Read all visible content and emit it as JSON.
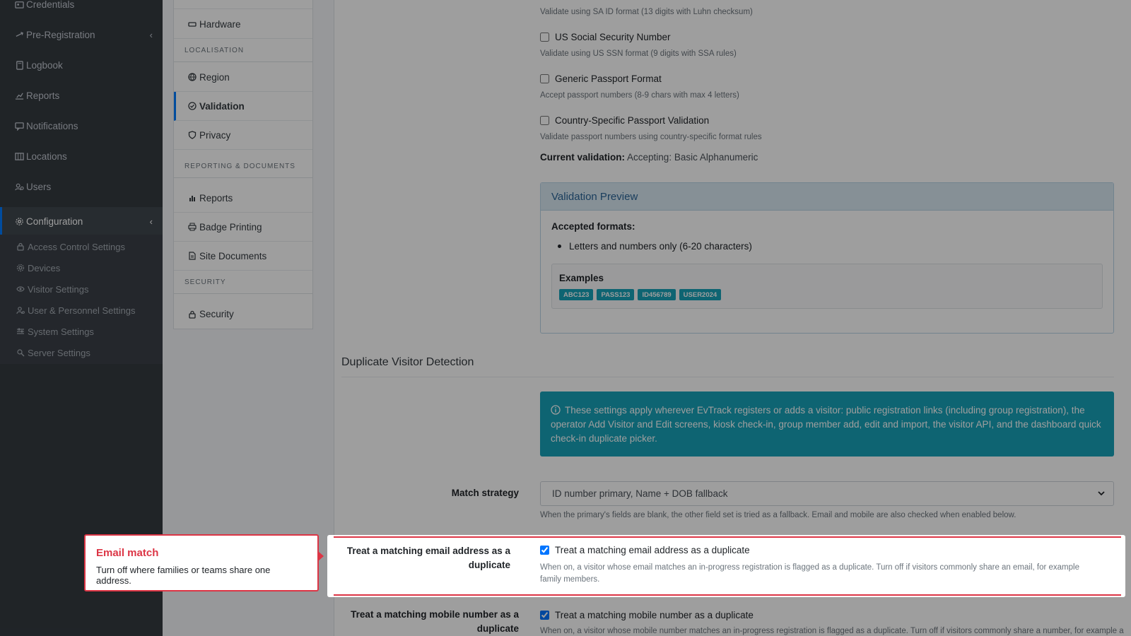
{
  "sidebar": {
    "items": [
      {
        "label": "Credentials",
        "icon": "id-card-icon"
      },
      {
        "label": "Pre-Registration",
        "icon": "arrows-icon",
        "chevron": "‹"
      },
      {
        "label": "Logbook",
        "icon": "book-icon"
      },
      {
        "label": "Reports",
        "icon": "chart-icon"
      },
      {
        "label": "Notifications",
        "icon": "message-icon"
      },
      {
        "label": "Locations",
        "icon": "map-icon"
      },
      {
        "label": "Users",
        "icon": "users-icon"
      },
      {
        "label": "Configuration",
        "icon": "gear-icon",
        "chevron": "‹"
      }
    ],
    "subitems": [
      {
        "label": "Access Control Settings",
        "icon": "lock-icon"
      },
      {
        "label": "Devices",
        "icon": "cog-icon"
      },
      {
        "label": "Visitor Settings",
        "icon": "eye-icon"
      },
      {
        "label": "User & Personnel Settings",
        "icon": "user-cog-icon"
      },
      {
        "label": "System Settings",
        "icon": "sliders-icon"
      },
      {
        "label": "Server Settings",
        "icon": "server-icon"
      }
    ]
  },
  "settings_menu": {
    "hardware": "Hardware",
    "localisation_header": "LOCALISATION",
    "region": "Region",
    "validation": "Validation",
    "privacy": "Privacy",
    "reporting_header": "REPORTING & DOCUMENTS",
    "reports": "Reports",
    "badge_printing": "Badge Printing",
    "site_documents": "Site Documents",
    "security_header": "SECURITY",
    "security": "Security"
  },
  "validation": {
    "sa_hint": "Validate using SA ID format (13 digits with Luhn checksum)",
    "us_ssn_label": "US Social Security Number",
    "us_ssn_hint": "Validate using US SSN format (9 digits with SSA rules)",
    "passport_label": "Generic Passport Format",
    "passport_hint": "Accept passport numbers (8-9 chars with max 4 letters)",
    "country_label": "Country-Specific Passport Validation",
    "country_hint": "Validate passport numbers using country-specific format rules",
    "current_label": "Current validation:",
    "current_value": "Accepting: Basic Alphanumeric"
  },
  "preview": {
    "title": "Validation Preview",
    "accepted_label": "Accepted formats:",
    "accepted_item": "Letters and numbers only (6-20 characters)",
    "examples_label": "Examples",
    "examples": [
      "ABC123",
      "PASS123",
      "ID456789",
      "USER2024"
    ]
  },
  "duplicate": {
    "section_title": "Duplicate Visitor Detection",
    "info_text": "These settings apply wherever EvTrack registers or adds a visitor: public registration links (including group registration), the operator Add Visitor and Edit screens, kiosk check-in, group member add, edit and import, the visitor API, and the dashboard quick check-in duplicate picker.",
    "match_label": "Match strategy",
    "match_value": "ID number primary, Name + DOB fallback",
    "match_hint": "When the primary's fields are blank, the other field set is tried as a fallback. Email and mobile are also checked when enabled below.",
    "email_label": "Treat a matching email address as a duplicate",
    "email_check_label": "Treat a matching email address as a duplicate",
    "email_hint": "When on, a visitor whose email matches an in-progress registration is flagged as a duplicate. Turn off if visitors commonly share an email, for example family members.",
    "mobile_label": "Treat a matching mobile number as a duplicate",
    "mobile_check_label": "Treat a matching mobile number as a duplicate",
    "mobile_hint": "When on, a visitor whose mobile number matches an in-progress registration is flagged as a duplicate. Turn off if visitors commonly share a number, for example a"
  },
  "tooltip": {
    "title": "Email match",
    "body": "Turn off where families or teams share one address."
  },
  "colors": {
    "sidebar": "#343a40",
    "accent": "#007bff",
    "info": "#17a2b8",
    "highlight": "#dc3545"
  }
}
